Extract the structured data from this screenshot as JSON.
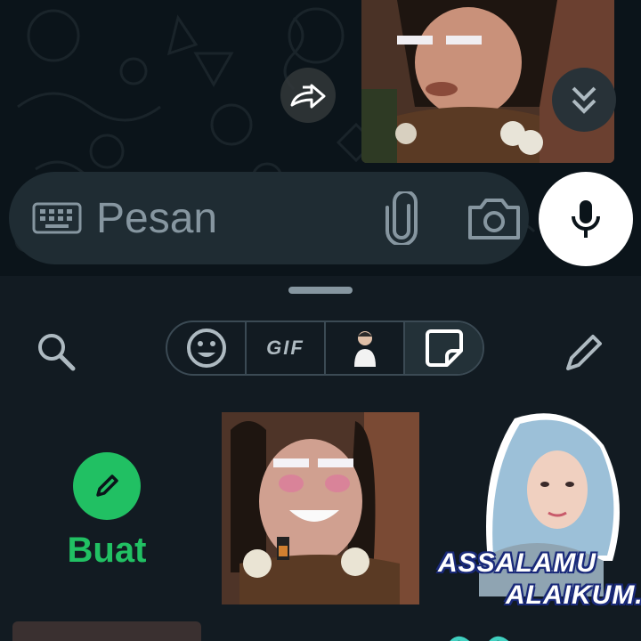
{
  "composer": {
    "placeholder": "Pesan"
  },
  "sticker_panel": {
    "tabs": [
      {
        "name": "emoji",
        "label": ""
      },
      {
        "name": "gif",
        "label": "GIF"
      },
      {
        "name": "avatar",
        "label": ""
      },
      {
        "name": "stickers",
        "label": ""
      }
    ],
    "active_tab": "stickers",
    "create_label": "Buat",
    "sticker_caption_line1": "ASSALAMU",
    "sticker_caption_line2": "ALAIKUM.."
  },
  "colors": {
    "accent_green": "#21c063",
    "background": "#0b141a",
    "input_bar": "#1f2c33",
    "icon_gray": "#8696a0"
  },
  "icons": [
    "forward-icon",
    "double-chevron-down-icon",
    "keyboard-icon",
    "paperclip-icon",
    "camera-icon",
    "microphone-icon",
    "search-icon",
    "emoji-icon",
    "gif-icon",
    "avatar-icon",
    "sticker-icon",
    "pencil-icon"
  ]
}
